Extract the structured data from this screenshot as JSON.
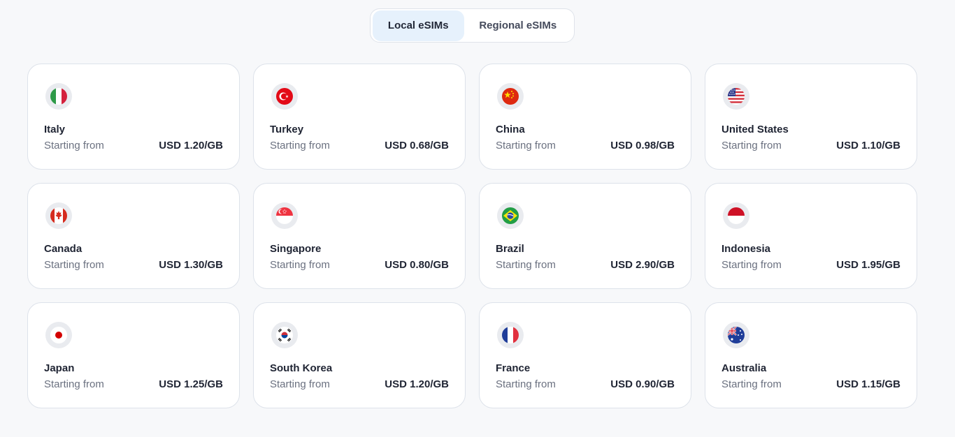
{
  "tabs": [
    {
      "label": "Local eSIMs",
      "active": true
    },
    {
      "label": "Regional eSIMs",
      "active": false
    }
  ],
  "cards": [
    {
      "country": "Italy",
      "flag": "italy-flag-icon",
      "from": "Starting from",
      "price": "USD 1.20/GB"
    },
    {
      "country": "Turkey",
      "flag": "turkey-flag-icon",
      "from": "Starting from",
      "price": "USD 0.68/GB"
    },
    {
      "country": "China",
      "flag": "china-flag-icon",
      "from": "Starting from",
      "price": "USD 0.98/GB"
    },
    {
      "country": "United States",
      "flag": "united-states-flag-icon",
      "from": "Starting from",
      "price": "USD 1.10/GB"
    },
    {
      "country": "Canada",
      "flag": "canada-flag-icon",
      "from": "Starting from",
      "price": "USD 1.30/GB"
    },
    {
      "country": "Singapore",
      "flag": "singapore-flag-icon",
      "from": "Starting from",
      "price": "USD 0.80/GB"
    },
    {
      "country": "Brazil",
      "flag": "brazil-flag-icon",
      "from": "Starting from",
      "price": "USD 2.90/GB"
    },
    {
      "country": "Indonesia",
      "flag": "indonesia-flag-icon",
      "from": "Starting from",
      "price": "USD 1.95/GB"
    },
    {
      "country": "Japan",
      "flag": "japan-flag-icon",
      "from": "Starting from",
      "price": "USD 1.25/GB"
    },
    {
      "country": "South Korea",
      "flag": "south-korea-flag-icon",
      "from": "Starting from",
      "price": "USD 1.20/GB"
    },
    {
      "country": "France",
      "flag": "france-flag-icon",
      "from": "Starting from",
      "price": "USD 0.90/GB"
    },
    {
      "country": "Australia",
      "flag": "australia-flag-icon",
      "from": "Starting from",
      "price": "USD 1.15/GB"
    }
  ]
}
